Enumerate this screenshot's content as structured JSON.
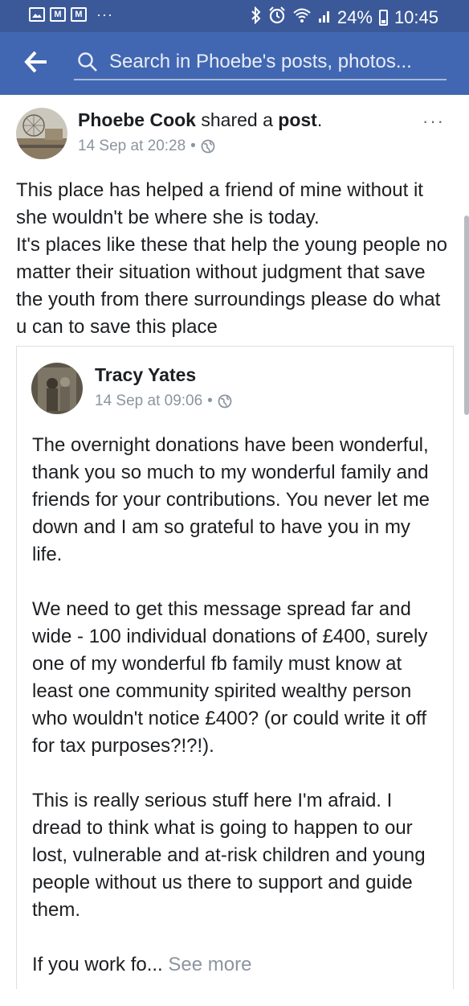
{
  "status_bar": {
    "notification_icons": [
      "gallery-icon",
      "gmail-icon",
      "gmail-icon"
    ],
    "more_notifications": "···",
    "battery": "24%",
    "time": "10:45"
  },
  "search": {
    "placeholder": "Search in Phoebe's posts, photos..."
  },
  "post": {
    "author": "Phoebe Cook",
    "action": "shared a",
    "object": "post",
    "object_suffix": ".",
    "time": "14 Sep at 20:28",
    "separator": "•",
    "more": "···",
    "paragraph_1": "This place has helped a friend of mine without it she wouldn't be where she is today.",
    "paragraph_2": "It's places like these that help the young people no matter their situation without judgment that save the youth from there surroundings please do what u can to save this place"
  },
  "shared_post": {
    "author": "Tracy Yates",
    "time": "14 Sep at 09:06",
    "separator": "•",
    "paragraphs": [
      "The overnight donations have been wonderful, thank you so much to my wonderful family and friends for your contributions. You never let me down and I am so grateful to have you in my life.",
      "We need to get this message spread far and wide - 100 individual donations of £400, surely one of my wonderful fb family must know at least one community spirited wealthy person who wouldn't notice £400? (or could write it off for tax purposes?!?!).",
      "This is really serious stuff here I'm afraid. I dread to think what is going to happen to our lost, vulnerable and at-risk children and young people without us there to support and guide them."
    ],
    "truncated_text": "If you work fo...",
    "see_more": "See more"
  },
  "colors": {
    "status_bar": "#3b5998",
    "header": "#4267b2",
    "text": "#1c1e21",
    "meta": "#8d949e"
  }
}
